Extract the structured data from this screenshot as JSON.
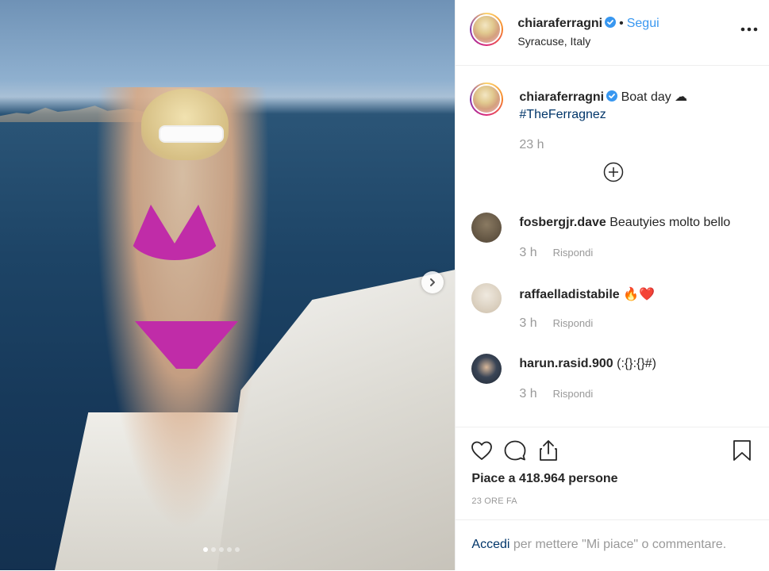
{
  "post": {
    "username": "chiaraferragni",
    "separator": "•",
    "follow_label": "Segui",
    "location": "Syracuse, Italy",
    "more_icon": "more-options-icon",
    "caption_text": "Boat day ☁",
    "caption_hashtag": "#TheFerragnez",
    "caption_time": "23 h",
    "load_more_icon": "plus-circle-icon"
  },
  "comments": [
    {
      "username": "fosbergjr.dave",
      "text": "Beautyies molto bello",
      "time": "3 h",
      "reply_label": "Rispondi",
      "avatar_color": "#6b5a44"
    },
    {
      "username": "raffaelladistabile",
      "text": "🔥❤️",
      "time": "3 h",
      "reply_label": "Rispondi",
      "avatar_color": "#d9cfc0"
    },
    {
      "username": "harun.rasid.900",
      "text": "(:{}:{}#)",
      "time": "3 h",
      "reply_label": "Rispondi",
      "avatar_color": "#2f3a4a"
    }
  ],
  "actions": {
    "like_icon": "heart-icon",
    "comment_icon": "comment-icon",
    "share_icon": "share-icon",
    "save_icon": "bookmark-icon",
    "likes_text": "Piace a 418.964 persone",
    "date_text": "23 ORE FA"
  },
  "login": {
    "link_text": "Accedi",
    "rest_text": " per mettere \"Mi piace\" o commentare."
  },
  "carousel": {
    "next_icon": "chevron-right-icon",
    "slide_count": 5,
    "active_index": 0
  },
  "colors": {
    "link_blue": "#3897f0",
    "hashtag": "#003569",
    "muted": "#999999",
    "verified": "#3897f0"
  }
}
